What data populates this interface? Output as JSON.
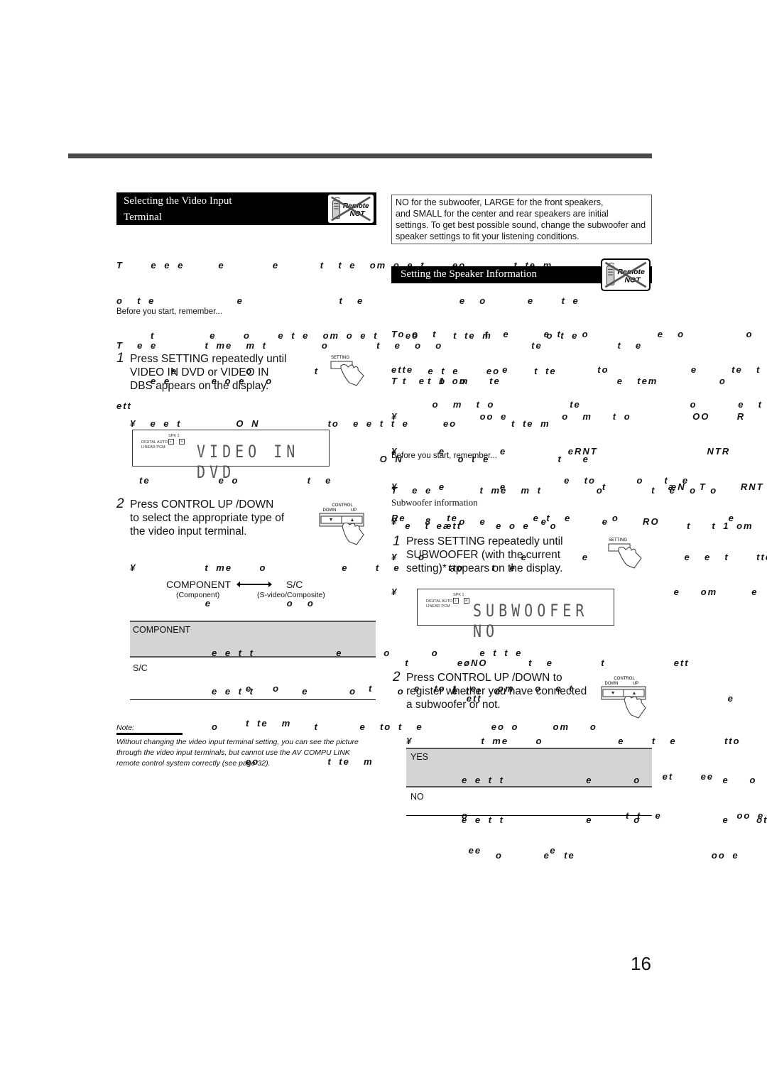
{
  "page": {
    "number": "16"
  },
  "left": {
    "header": {
      "line1": "Selecting the Video Input",
      "line2": "Terminal",
      "badge_top": "Remote",
      "badge_bottom": "NOT"
    },
    "intro_lines": [
      "T    e e e     e       e      t  t e  om o e t    eo       t te m",
      "o  t e            e              t  e              e  o      e    t e",
      "     t        e    o    e t e  om o e t    eo     t te m        o t e",
      "        e          o         t    e           e t e    eo     t te",
      "ett"
    ],
    "before_start": {
      "label": "Before you start, remember...",
      "lines": [
        "T  e e       t me  m t        o       t  e  o  o             te           t  e",
        "     e e      e o e   o                   t   t 1 om   te"
      ]
    },
    "step1": {
      "num": "1",
      "lines": [
        "Press SETTING repeatedly until",
        " VIDEO IN DVD    or   VIDEO IN",
        "DBS   appears on the display."
      ],
      "bullets": [
        "¥  e e t        O N          to  e e t t e     eo        t te m",
        "    t e                  e           O N        o t e          t   e"
      ],
      "button_label": "SETTING"
    },
    "display1": {
      "label1": "DIGITAL AUTO",
      "label2": "LINEAR PCM",
      "spk": "SPK  1",
      "l": "L",
      "r": "R",
      "text": "VIDEO IN DVD"
    },
    "after_display": "te          e o          t  e                                  e  to      o   t  e",
    "step2": {
      "num": "2",
      "lines": [
        "Press CONTROL UP    /DOWN",
        "to select the appropriate type of",
        "the video input terminal."
      ],
      "bullets": [
        "¥          t me    o           e    t  e       tto    t  e",
        "           e           o  o"
      ],
      "control_label": "CONTROL",
      "down_label": "DOWN",
      "up_label": "UP"
    },
    "toggle": {
      "a": "COMPONENT",
      "b": "S/C",
      "a_sub": "(Component)",
      "b_sub": "(S-video/Composite)"
    },
    "table": [
      {
        "key": "COMPONENT",
        "lines": [
          "e e t t            e      o      o      e t t e",
          "     e   o             t      e  to t  e   om   o  e t",
          "     t te  m"
        ]
      },
      {
        "key": "S/C",
        "lines": [
          "e e t t       e      o      o       e t t  e",
          "o              t      e  to t  e          eo o     om   o",
          "     eo          t te  m"
        ]
      }
    ],
    "note": {
      "label": "Note:",
      "text": "Without changing the video input terminal setting, you can see the picture through the video input terminals, but cannot use the AV COMPU LINK remote control system correctly (see page 32)."
    }
  },
  "right": {
    "infobox": {
      "lines": [
        " NO   for the subwoofer,  LARGE    for the front speakers,",
        "and   SMALL    for the center and rear speakers are initial",
        "settings. To get best possible sound, change the subwoofer and",
        "speaker settings to fit your listening conditions."
      ]
    },
    "header": {
      "title": "Setting the Speaker Information",
      "badge_top": "Remote",
      "badge_bottom": "NOT"
    },
    "intro_lines": [
      "To o  t       t  e     e t   o          e  o         o  e  e t    om               o          mo",
      "ette             e             to            e     te  t e  o  o                   e        e",
      "      o  m  t o           te                o      e  t o              e   om    ete"
    ],
    "list_title": "T   e  o  o                      e  tem         o                  et",
    "list": [
      "¥            oo e        o  m   t o         OO    R",
      "¥      e        e         eRNT                NTR              R      R",
      "¥      e        e              t         æN  T     RNT              NTR                R      R",
      "¥    8    o  e        e        e     RO",
      "¥   o              e        e              e  e  t    tte           to TT",
      "¥                 m                      e   om     e     o O"
    ],
    "before_start": {
      "label": "Before you start, remember...",
      "lines": [
        "T  e e       t me  m t        o       t  e  o  o             te           t  e   ett",
        "  e  t eætt     e o e   o                   t   t 1 om   te"
      ]
    },
    "subwoofer_heading": "Subwoofer information",
    "subwoofer_intro": "Re      te           e t  e      o                e     o       e  te                        oo e   o       ot",
    "step1": {
      "num": "1",
      "lines": [
        "Press SETTING repeatedly until",
        " SUBWOOFER   (with the current",
        "setting)* appears on the display."
      ],
      "button_label": "SETTING"
    },
    "display2": {
      "label1": "DIGITAL AUTO",
      "label2": "LINEAR PCM",
      "spk": "SPK  1",
      "l": "L",
      "r": "R",
      "text": "SUBWOOFER NO"
    },
    "after_display": [
      "  t       eøNO      t  e       t          ett                     o                 e          e                        e   t",
      "           ett                                    e     o"
    ],
    "step2": {
      "num": "2",
      "lines": [
        "Press CONTROL UP    /DOWN      to",
        "register whether you have connected",
        "a subwoofer or not."
      ],
      "bullets": [
        "¥          t me    o           e    t  e       tto    t  e              oo",
        "     ett            te         te      et    ee          NO"
      ],
      "control_label": "CONTROL",
      "down_label": "DOWN",
      "up_label": "UP"
    },
    "table": [
      {
        "key": "YES",
        "lines": [
          "e e t t            e      o            e   o     e  te                          oo",
          "o                       t t  e           oo e   o  t     t  e  e",
          " ee          e"
        ]
      },
      {
        "key": "NO",
        "lines": [
          "e e t t            e      o            e    ot    o     e  te    o",
          "     o      e  te                    oo e"
        ]
      }
    ]
  }
}
